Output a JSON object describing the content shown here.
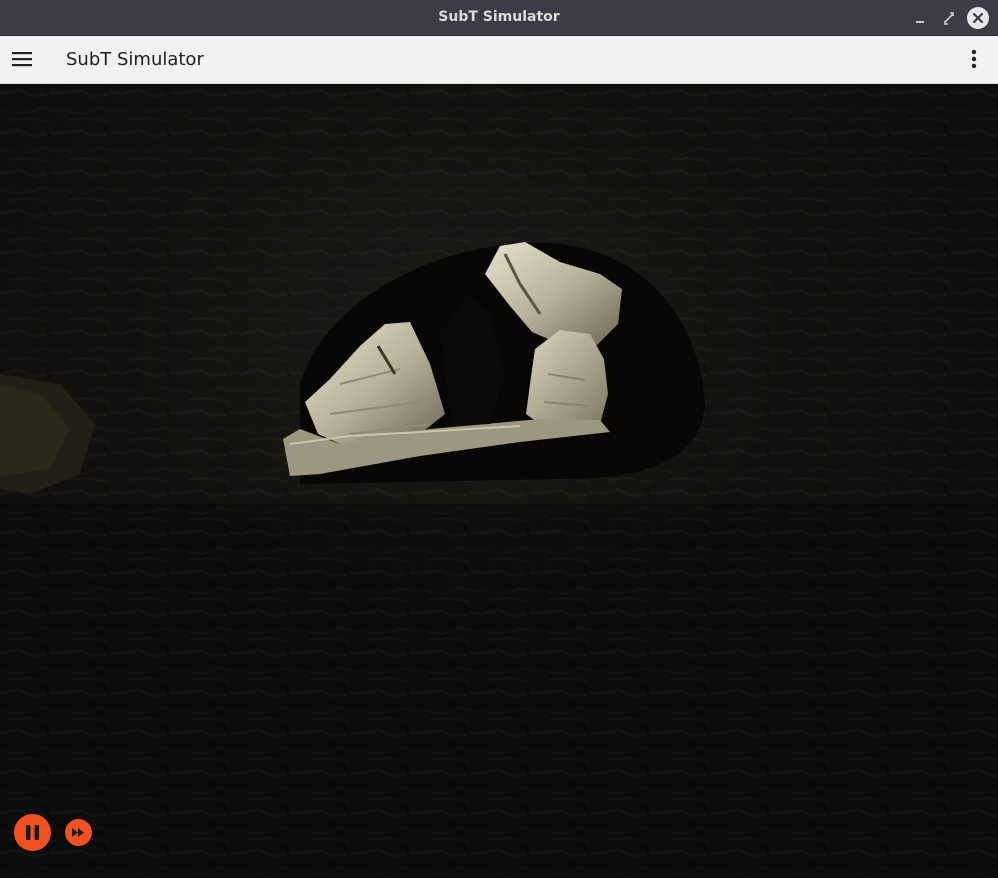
{
  "window": {
    "title": "SubT Simulator"
  },
  "appbar": {
    "title": "SubT Simulator",
    "menu_icon": "hamburger-menu-icon",
    "overflow_icon": "more-vert-icon"
  },
  "viewport": {
    "scene": "underground-cave",
    "background_color": "#0d0c0b"
  },
  "controls": {
    "pause_icon": "pause-icon",
    "step_icon": "fast-forward-icon",
    "accent_color": "#f4511e"
  }
}
